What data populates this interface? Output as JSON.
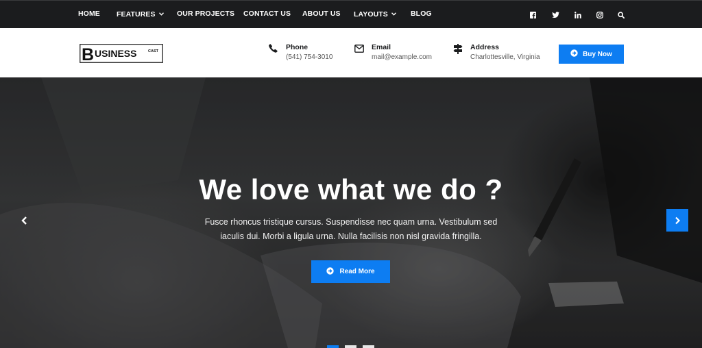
{
  "nav": {
    "items": [
      {
        "label": "HOME",
        "caret": false
      },
      {
        "label": "FEATURES",
        "caret": true
      },
      {
        "label": "OUR PROJECTS",
        "caret": false
      },
      {
        "label": "CONTACT US",
        "caret": false
      },
      {
        "label": "ABOUT US",
        "caret": false
      },
      {
        "label": "LAYOUTS",
        "caret": true
      },
      {
        "label": "BLOG",
        "caret": false
      }
    ],
    "social_icons": [
      "facebook-icon",
      "twitter-icon",
      "linkedin-icon",
      "instagram-icon",
      "search-icon"
    ]
  },
  "header": {
    "logo": {
      "big_letter": "B",
      "text": "USINESS",
      "small": "CAST"
    },
    "phone": {
      "label": "Phone",
      "value": "(541) 754-3010",
      "icon": "phone-icon"
    },
    "email": {
      "label": "Email",
      "value": "mail@example.com",
      "icon": "envelope-icon"
    },
    "address": {
      "label": "Address",
      "value": "Charlottesville, Virginia",
      "icon": "signpost-icon"
    },
    "buy_button": "Buy Now"
  },
  "hero": {
    "title": "We love what we do ?",
    "text_line1": "Fusce rhoncus tristique cursus. Suspendisse nec quam urna. Vestibulum sed",
    "text_line2": "iaculis dui. Morbi a ligula urna. Nulla facilisis non nisl gravida fringilla.",
    "read_more": "Read More",
    "slides_total": 3,
    "slide_active": 1
  },
  "colors": {
    "accent": "#0d7df2",
    "topbar": "#1b1c1e",
    "text_dark": "#1b1c1e"
  }
}
